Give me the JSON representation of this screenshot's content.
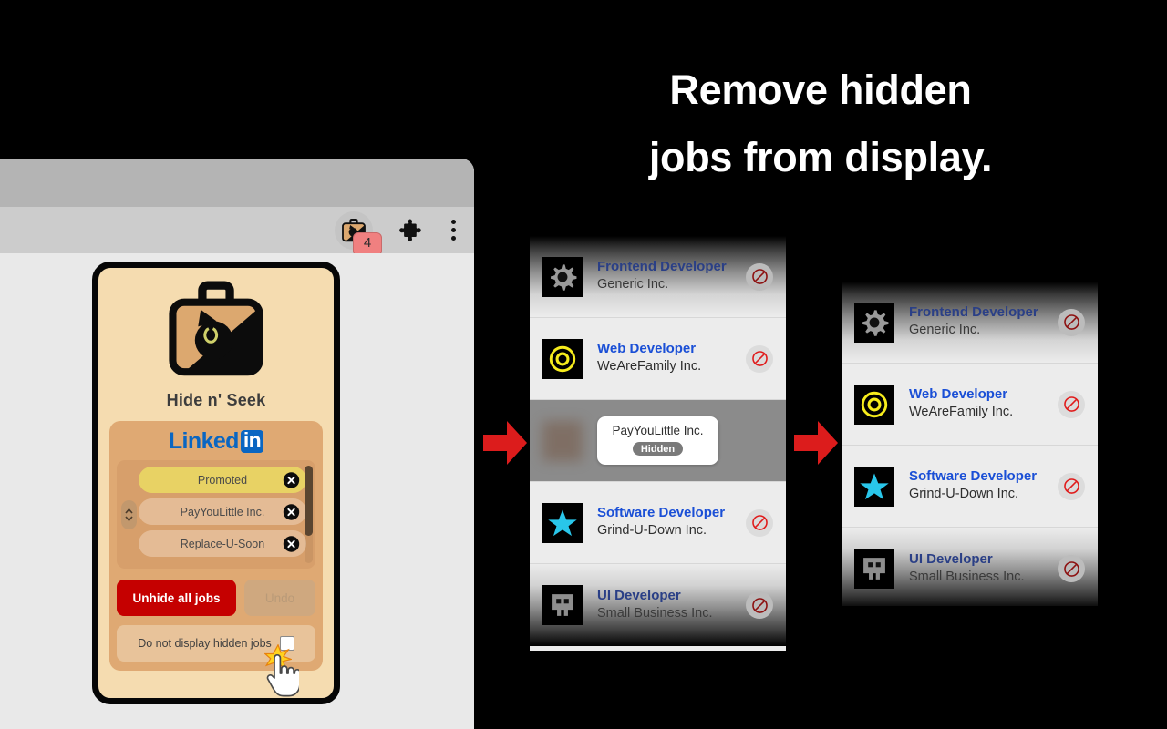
{
  "headline": {
    "line1": "Remove hidden",
    "line2": "jobs from display."
  },
  "browser": {
    "extension_badge_count": "4",
    "extension_icon": "briefcase-cat-icon",
    "puzzle_icon": "extensions-puzzle-icon",
    "menu_icon": "kebab-menu-icon"
  },
  "popup": {
    "app_title": "Hide n' Seek",
    "app_icon": "briefcase-cat-icon",
    "site": {
      "name_part1": "Linked",
      "name_part2": "in",
      "brand_color": "#0a66c2"
    },
    "hidden_entries": [
      {
        "label": "Promoted",
        "kind": "promoted",
        "remove_icon": "close-circle-icon"
      },
      {
        "label": "PayYouLittle Inc.",
        "kind": "company",
        "remove_icon": "close-circle-icon"
      },
      {
        "label": "Replace-U-Soon",
        "kind": "company",
        "remove_icon": "close-circle-icon"
      }
    ],
    "buttons": {
      "unhide_all": "Unhide all jobs",
      "undo": "Undo"
    },
    "preference": {
      "label": "Do not display hidden jobs",
      "checked": false
    },
    "drag_handle_icon": "up-down-chevrons-icon",
    "scrollbar": "vertical-scrollbar"
  },
  "panels": {
    "before": {
      "name": "job-list-before",
      "rows": [
        {
          "title": "Frontend Developer",
          "company": "Generic Inc.",
          "logo": "gear-icon",
          "state": "fade-top",
          "action_icon": "block-icon"
        },
        {
          "title": "Web Developer",
          "company": "WeAreFamily Inc.",
          "logo": "target-rings-icon",
          "state": "normal",
          "action_icon": "block-icon"
        },
        {
          "title": "",
          "company": "PayYouLittle Inc.",
          "logo": "blurred-logo",
          "state": "hidden",
          "badge": "Hidden",
          "action_icon": ""
        },
        {
          "title": "Software Developer",
          "company": "Grind-U-Down Inc.",
          "logo": "star-icon",
          "state": "normal",
          "action_icon": "block-icon"
        },
        {
          "title": "UI Developer",
          "company": "Small Business Inc.",
          "logo": "robot-face-icon",
          "state": "fade-bottom",
          "action_icon": "block-icon"
        }
      ]
    },
    "after": {
      "name": "job-list-after",
      "rows": [
        {
          "title": "Frontend Developer",
          "company": "Generic Inc.",
          "logo": "gear-icon",
          "state": "fade-top",
          "action_icon": "block-icon"
        },
        {
          "title": "Web Developer",
          "company": "WeAreFamily Inc.",
          "logo": "target-rings-icon",
          "state": "normal",
          "action_icon": "block-icon"
        },
        {
          "title": "Software Developer",
          "company": "Grind-U-Down Inc.",
          "logo": "star-icon",
          "state": "normal",
          "action_icon": "block-icon"
        },
        {
          "title": "UI Developer",
          "company": "Small Business Inc.",
          "logo": "robot-face-icon",
          "state": "fade-bottom",
          "action_icon": "block-icon"
        }
      ]
    }
  },
  "arrows": {
    "first": "right-arrow-icon",
    "second": "right-arrow-icon",
    "color": "#dc1c1c"
  },
  "colors": {
    "background": "#000000",
    "popup_bg": "#f5dcb0",
    "popup_panel": "#dfa973",
    "unhide_button": "#c50000",
    "job_title_link": "#1a4fd6",
    "badge": "#f08080"
  },
  "cursor": {
    "icon": "pointing-hand-cursor",
    "burst": "click-burst-icon"
  }
}
